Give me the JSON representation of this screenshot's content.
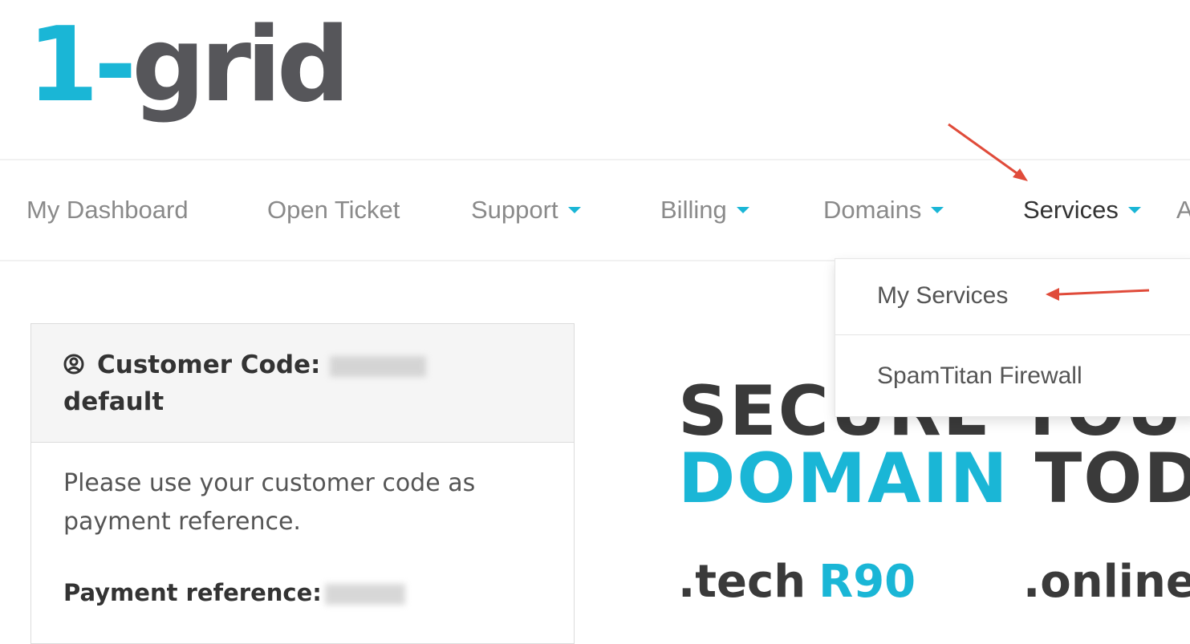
{
  "logo": {
    "part1": "1-",
    "part2": "grid"
  },
  "nav": {
    "items": [
      {
        "label": "My Dashboard",
        "dropdown": false
      },
      {
        "label": "Open Ticket",
        "dropdown": false
      },
      {
        "label": "Support",
        "dropdown": true
      },
      {
        "label": "Billing",
        "dropdown": true
      },
      {
        "label": "Domains",
        "dropdown": true
      },
      {
        "label": "Services",
        "dropdown": true,
        "active": true
      },
      {
        "label": "A",
        "dropdown": false
      }
    ]
  },
  "services_menu": {
    "items": [
      {
        "label": "My Services"
      },
      {
        "label": "SpamTitan Firewall"
      }
    ]
  },
  "panel": {
    "title_prefix": "Customer Code:",
    "title_suffix": "default",
    "body": "Please use your customer code as payment reference.",
    "payment_ref_label": "Payment reference:"
  },
  "promo": {
    "line1": "SECURE YOUR",
    "line2_accent": "DOMAIN",
    "line2_dark": "TODAY",
    "offers": [
      {
        "ext": ".tech",
        "price": "R90"
      },
      {
        "ext": ".online",
        "price": ""
      }
    ]
  },
  "colors": {
    "brand": "#1ab6d6",
    "logo_dark": "#56565a",
    "annotation": "#e04b3a"
  }
}
